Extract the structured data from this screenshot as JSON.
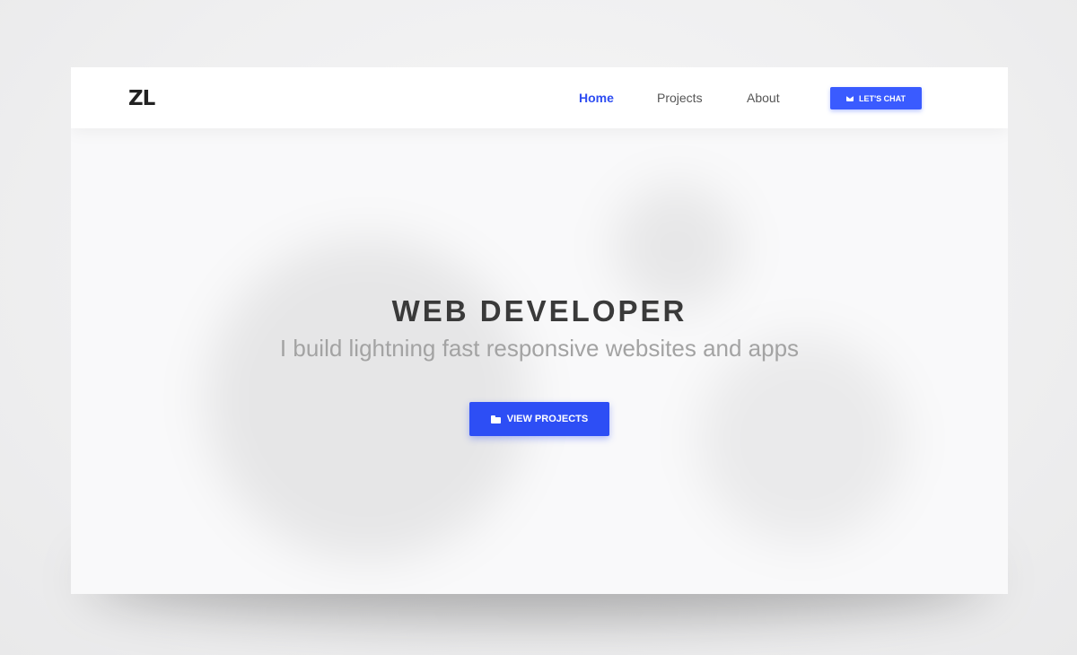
{
  "brand": {
    "logo_text": "ZL",
    "accent_color": "#3a5bff"
  },
  "nav": {
    "items": [
      {
        "label": "Home",
        "active": true
      },
      {
        "label": "Projects",
        "active": false
      },
      {
        "label": "About",
        "active": false
      }
    ],
    "cta": {
      "label": "LET'S CHAT",
      "icon": "envelope-icon"
    }
  },
  "hero": {
    "title": "WEB DEVELOPER",
    "subtitle": "I build lightning fast responsive websites and apps",
    "button": {
      "label": "VIEW PROJECTS",
      "icon": "folder-open-icon"
    }
  }
}
